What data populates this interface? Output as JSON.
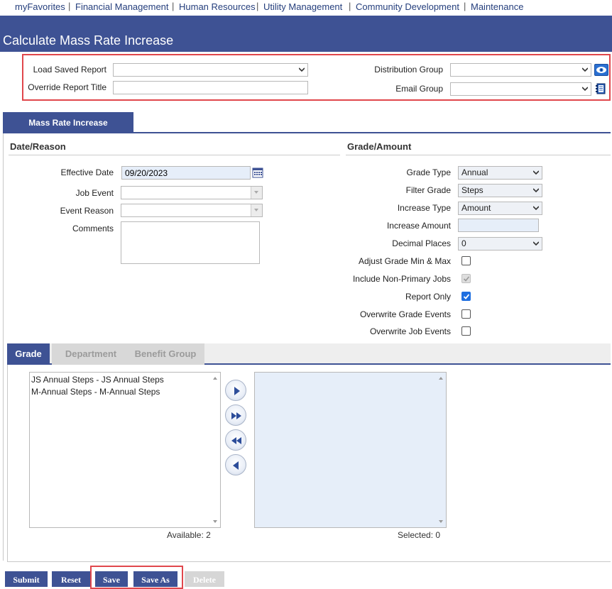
{
  "nav": {
    "items": [
      "myFavorites",
      "Financial Management",
      "Human Resources",
      "Utility Management",
      "Community Development",
      "Maintenance"
    ],
    "separator": "|"
  },
  "page": {
    "title": "Calculate Mass Rate Increase"
  },
  "report": {
    "load_saved_label": "Load Saved Report",
    "load_saved_value": "",
    "override_title_label": "Override Report Title",
    "override_title_value": "",
    "distribution_group_label": "Distribution Group",
    "distribution_group_value": "",
    "email_group_label": "Email Group",
    "email_group_value": ""
  },
  "tabs": {
    "main": "Mass Rate Increase"
  },
  "date_reason": {
    "heading": "Date/Reason",
    "effective_date_label": "Effective Date",
    "effective_date_value": "09/20/2023",
    "job_event_label": "Job Event",
    "job_event_value": "",
    "event_reason_label": "Event Reason",
    "event_reason_value": "",
    "comments_label": "Comments",
    "comments_value": ""
  },
  "grade_amount": {
    "heading": "Grade/Amount",
    "grade_type_label": "Grade Type",
    "grade_type_value": "Annual",
    "filter_grade_label": "Filter Grade",
    "filter_grade_value": "Steps",
    "increase_type_label": "Increase Type",
    "increase_type_value": "Amount",
    "increase_amount_label": "Increase Amount",
    "increase_amount_value": "",
    "decimal_places_label": "Decimal Places",
    "decimal_places_value": "0",
    "adjust_minmax_label": "Adjust Grade Min & Max",
    "include_nonprimary_label": "Include Non-Primary Jobs",
    "report_only_label": "Report Only",
    "overwrite_grade_label": "Overwrite Grade Events",
    "overwrite_job_label": "Overwrite Job Events"
  },
  "subtabs": [
    "Grade",
    "Department",
    "Benefit Group"
  ],
  "grade_lists": {
    "available": [
      "JS Annual Steps - JS Annual Steps",
      "M-Annual Steps - M-Annual Steps"
    ],
    "available_count": "Available: 2",
    "selected": [],
    "selected_count": "Selected: 0"
  },
  "buttons": {
    "submit": "Submit",
    "reset": "Reset",
    "save": "Save",
    "save_as": "Save As",
    "delete": "Delete"
  },
  "colors": {
    "brand": "#3e5294",
    "highlight": "#e0474c",
    "field_blue": "#e6eef9",
    "checkbox_on": "#1f6fe0"
  }
}
